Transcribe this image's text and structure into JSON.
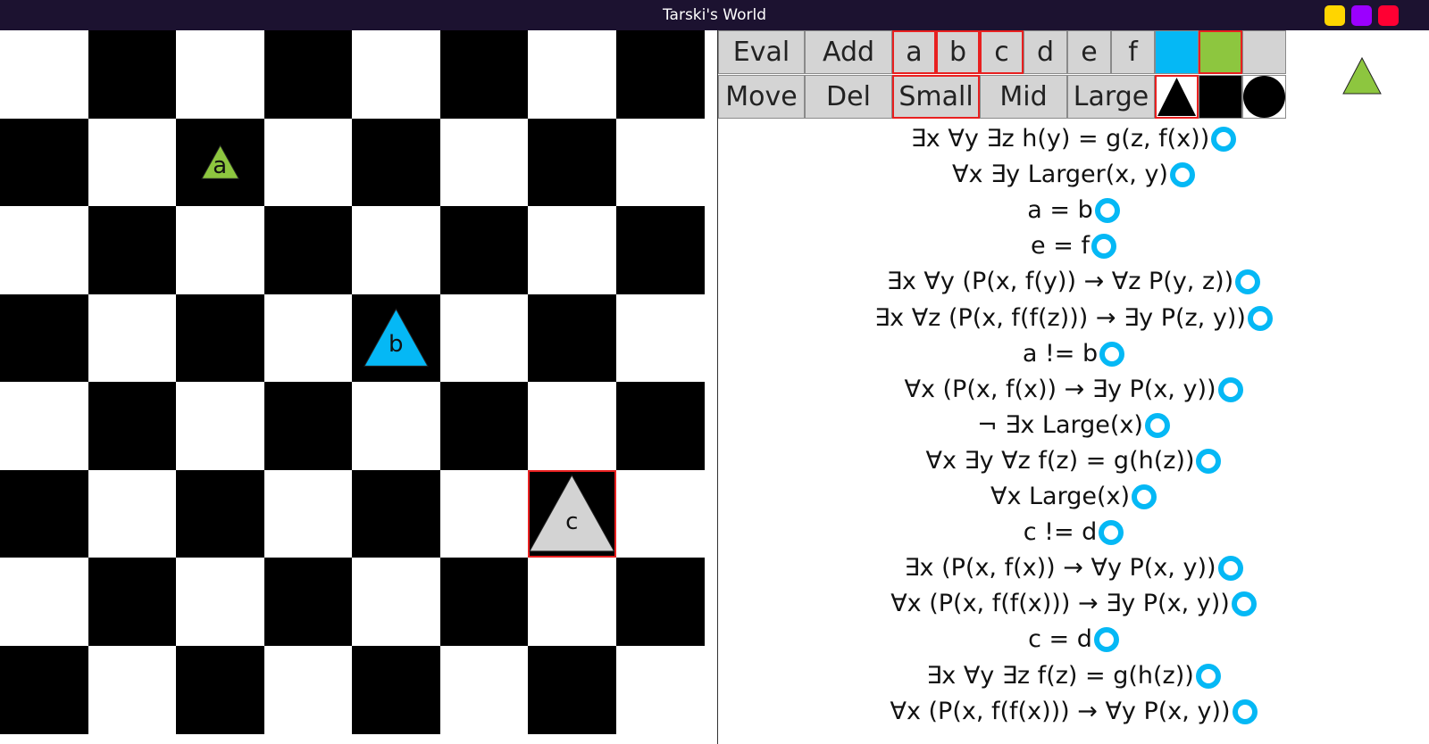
{
  "window": {
    "title": "Tarski's World",
    "buttons": [
      {
        "name": "minimize",
        "color": "#ffd500"
      },
      {
        "name": "maximize",
        "color": "#9b00ff"
      },
      {
        "name": "close",
        "color": "#ff0033"
      }
    ]
  },
  "colors": {
    "board_dark": "#000000",
    "board_light": "#ffffff",
    "selection": "#e82020",
    "piece_blue": "#05b8f5",
    "piece_green": "#8dc63f",
    "piece_gray": "#d3d3d3",
    "eval_ring": "#05b8f5"
  },
  "board": {
    "size": 8,
    "pieces": [
      {
        "label": "a",
        "shape": "triangle-icon",
        "size": "small",
        "color": "#8dc63f",
        "col": 2,
        "row": 1,
        "selected": false
      },
      {
        "label": "b",
        "shape": "triangle-icon",
        "size": "medium",
        "color": "#05b8f5",
        "col": 4,
        "row": 3,
        "selected": false
      },
      {
        "label": "c",
        "shape": "triangle-icon",
        "size": "large",
        "color": "#d3d3d3",
        "col": 6,
        "row": 5,
        "selected": true
      }
    ]
  },
  "toolbar": {
    "eval": "Eval",
    "add": "Add",
    "move": "Move",
    "del": "Del",
    "constants": [
      {
        "label": "a",
        "selected": true
      },
      {
        "label": "b",
        "selected": true
      },
      {
        "label": "c",
        "selected": true
      },
      {
        "label": "d",
        "selected": false
      },
      {
        "label": "e",
        "selected": false
      },
      {
        "label": "f",
        "selected": false
      }
    ],
    "sizes": [
      {
        "label": "Small",
        "selected": true
      },
      {
        "label": "Mid",
        "selected": false
      },
      {
        "label": "Large",
        "selected": false
      }
    ],
    "colors": [
      {
        "name": "blue",
        "value": "#05b8f5",
        "selected": false
      },
      {
        "name": "green",
        "value": "#8dc63f",
        "selected": true
      },
      {
        "name": "gray",
        "value": "#d3d3d3",
        "selected": false
      }
    ],
    "shapes": [
      {
        "name": "triangle-icon",
        "selected": true
      },
      {
        "name": "square-icon",
        "selected": false
      },
      {
        "name": "circle-icon",
        "selected": false
      }
    ]
  },
  "preview": {
    "shape": "triangle-icon",
    "color": "#8dc63f"
  },
  "formulas": [
    "∃x ∀y ∃z h(y) = g(z, f(x))",
    "∀x ∃y Larger(x, y)",
    "a = b",
    "e = f",
    "∃x ∀y (P(x, f(y)) → ∀z P(y, z))",
    "∃x ∀z (P(x, f(f(z))) → ∃y P(z, y))",
    "a != b",
    "∀x (P(x, f(x)) → ∃y P(x, y))",
    "¬ ∃x Large(x)",
    "∀x ∃y ∀z f(z) = g(h(z))",
    "∀x Large(x)",
    "c != d",
    "∃x (P(x, f(x)) → ∀y P(x, y))",
    "∀x (P(x, f(f(x))) → ∃y P(x, y))",
    "c = d",
    "∃x ∀y ∃z f(z) = g(h(z))",
    "∀x (P(x, f(f(x))) → ∀y P(x, y))"
  ]
}
